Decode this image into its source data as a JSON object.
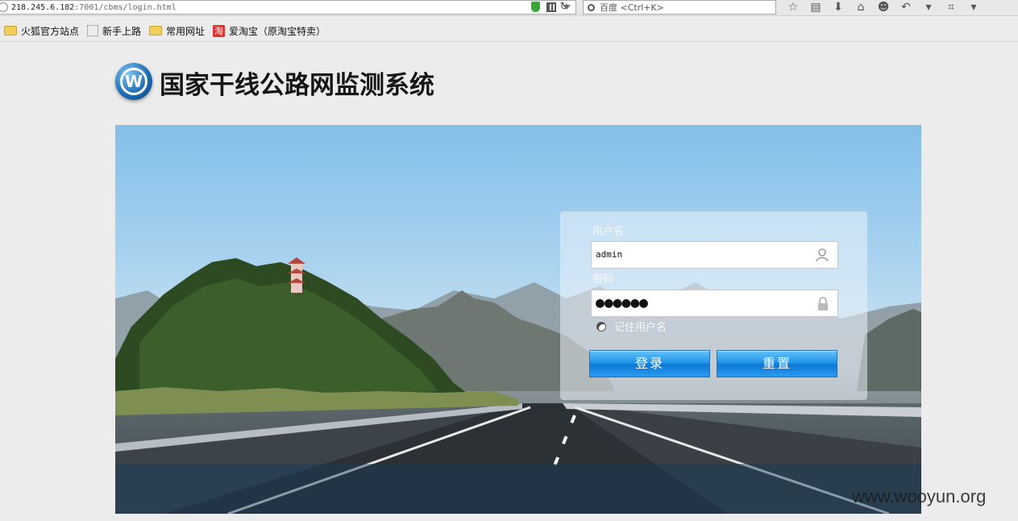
{
  "browser": {
    "url_host": "218.245.6.182",
    "url_rest": ":7001/cbms/login.html",
    "search_placeholder": "百度 <Ctrl+K>"
  },
  "bookmarks": [
    {
      "label": "火狐官方站点",
      "icon": "folder-icon"
    },
    {
      "label": "新手上路",
      "icon": "blank-page-icon"
    },
    {
      "label": "常用网址",
      "icon": "folder-icon"
    },
    {
      "label": "爱淘宝（原淘宝特卖）",
      "icon": "taobao-icon",
      "icon_text": "淘"
    }
  ],
  "header": {
    "logo_letter": "W",
    "title": "国家干线公路网监测系统"
  },
  "login": {
    "username_label": "用户名",
    "username_value": "admin",
    "password_label": "密码",
    "password_value": "●●●●●●",
    "remember_label": "记住用户名",
    "login_button": "登录",
    "reset_button": "重置"
  },
  "watermark": "www.wooyun.org",
  "colors": {
    "button_blue": "#1f94e8",
    "page_bg": "#ececec"
  }
}
